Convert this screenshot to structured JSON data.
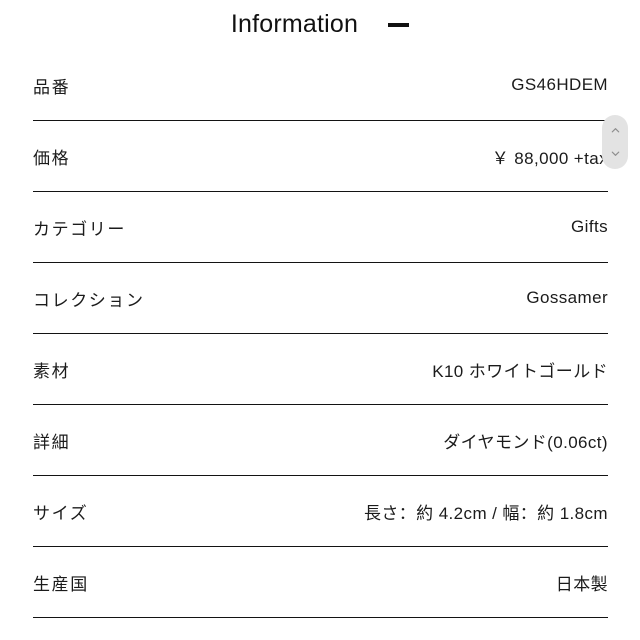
{
  "header": {
    "title": "Information",
    "toggle_icon": "minus-icon"
  },
  "scroll_stepper": {
    "up_icon": "chevron-up-icon",
    "down_icon": "chevron-down-icon",
    "track_color": "#e3e3e3",
    "chevron_color": "#8d8d8d"
  },
  "colors": {
    "text": "#1b1b1b",
    "divider": "#131313",
    "background": "#ffffff"
  },
  "spec_table": {
    "rows": [
      {
        "label": "品番",
        "value": "GS46HDEM"
      },
      {
        "label": "価格",
        "value": "￥ 88,000 +tax"
      },
      {
        "label": "カテゴリー",
        "value": "Gifts"
      },
      {
        "label": "コレクション",
        "value": "Gossamer"
      },
      {
        "label": "素材",
        "value": "K10 ホワイトゴールド"
      },
      {
        "label": "詳細",
        "value": "ダイヤモンド(0.06ct)"
      },
      {
        "label": "サイズ",
        "value": "長さ：約 4.2cm / 幅：約 1.8cm"
      },
      {
        "label": "生産国",
        "value": "日本製"
      }
    ]
  }
}
